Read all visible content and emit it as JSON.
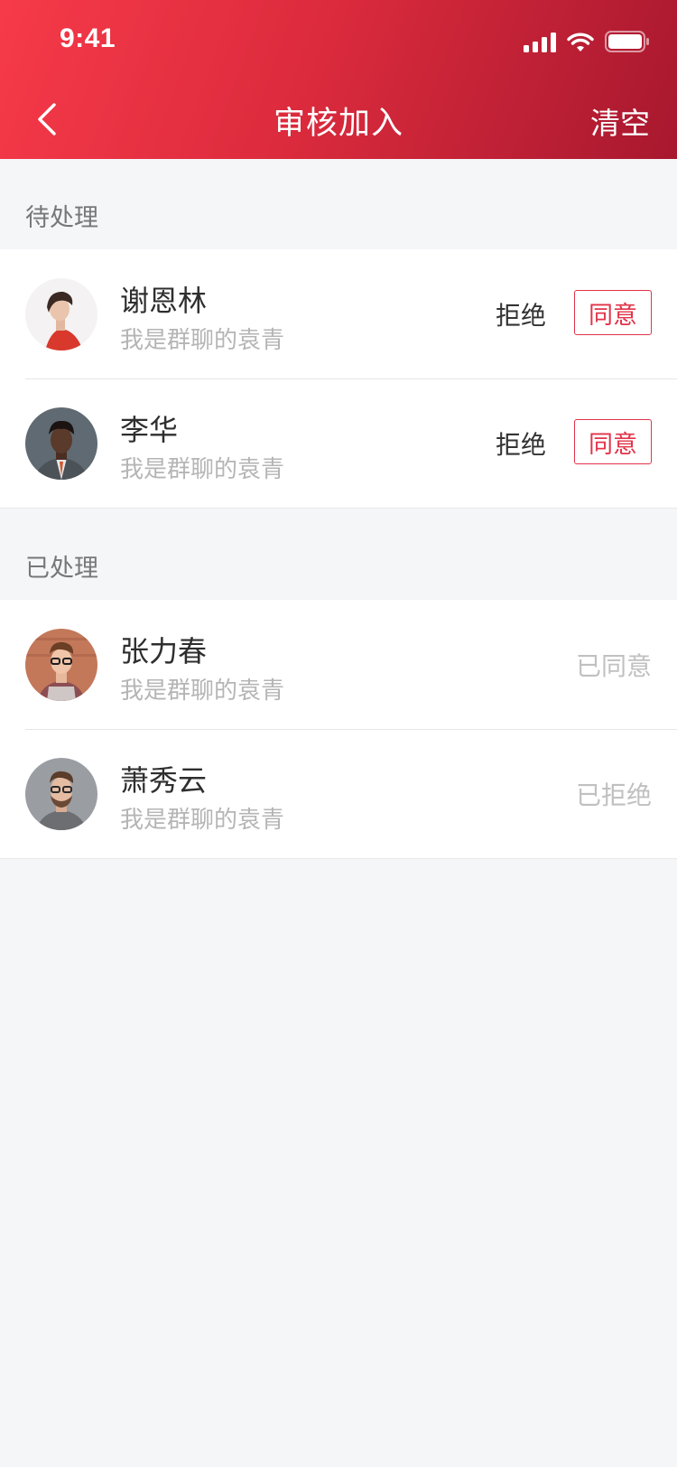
{
  "status_bar": {
    "time": "9:41"
  },
  "nav": {
    "title": "审核加入",
    "right_action": "清空"
  },
  "pending": {
    "label": "待处理",
    "items": [
      {
        "name": "谢恩林",
        "subtitle": "我是群聊的袁青",
        "reject_label": "拒绝",
        "agree_label": "同意"
      },
      {
        "name": "李华",
        "subtitle": "我是群聊的袁青",
        "reject_label": "拒绝",
        "agree_label": "同意"
      }
    ]
  },
  "processed": {
    "label": "已处理",
    "items": [
      {
        "name": "张力春",
        "subtitle": "我是群聊的袁青",
        "status": "已同意"
      },
      {
        "name": "萧秀云",
        "subtitle": "我是群聊的袁青",
        "status": "已拒绝"
      }
    ]
  },
  "colors": {
    "header_gradient_start": "#f63a49",
    "header_gradient_end": "#a8182f",
    "accent": "#e13349",
    "background": "#f5f6f8"
  },
  "icons": [
    "signal-icon",
    "wifi-icon",
    "battery-icon",
    "back-arrow-icon"
  ]
}
